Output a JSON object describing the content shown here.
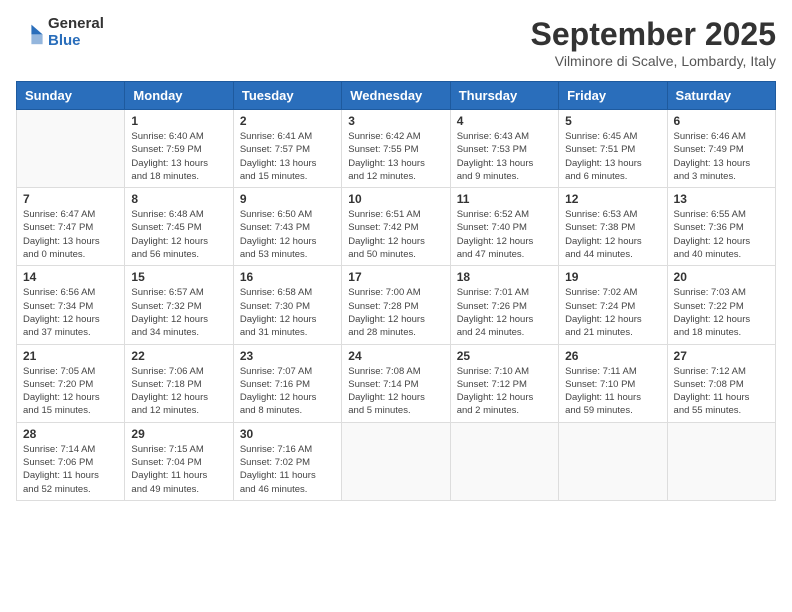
{
  "logo": {
    "general": "General",
    "blue": "Blue"
  },
  "title": "September 2025",
  "location": "Vilminore di Scalve, Lombardy, Italy",
  "headers": [
    "Sunday",
    "Monday",
    "Tuesday",
    "Wednesday",
    "Thursday",
    "Friday",
    "Saturday"
  ],
  "weeks": [
    [
      {
        "day": "",
        "info": ""
      },
      {
        "day": "1",
        "info": "Sunrise: 6:40 AM\nSunset: 7:59 PM\nDaylight: 13 hours\nand 18 minutes."
      },
      {
        "day": "2",
        "info": "Sunrise: 6:41 AM\nSunset: 7:57 PM\nDaylight: 13 hours\nand 15 minutes."
      },
      {
        "day": "3",
        "info": "Sunrise: 6:42 AM\nSunset: 7:55 PM\nDaylight: 13 hours\nand 12 minutes."
      },
      {
        "day": "4",
        "info": "Sunrise: 6:43 AM\nSunset: 7:53 PM\nDaylight: 13 hours\nand 9 minutes."
      },
      {
        "day": "5",
        "info": "Sunrise: 6:45 AM\nSunset: 7:51 PM\nDaylight: 13 hours\nand 6 minutes."
      },
      {
        "day": "6",
        "info": "Sunrise: 6:46 AM\nSunset: 7:49 PM\nDaylight: 13 hours\nand 3 minutes."
      }
    ],
    [
      {
        "day": "7",
        "info": "Sunrise: 6:47 AM\nSunset: 7:47 PM\nDaylight: 13 hours\nand 0 minutes."
      },
      {
        "day": "8",
        "info": "Sunrise: 6:48 AM\nSunset: 7:45 PM\nDaylight: 12 hours\nand 56 minutes."
      },
      {
        "day": "9",
        "info": "Sunrise: 6:50 AM\nSunset: 7:43 PM\nDaylight: 12 hours\nand 53 minutes."
      },
      {
        "day": "10",
        "info": "Sunrise: 6:51 AM\nSunset: 7:42 PM\nDaylight: 12 hours\nand 50 minutes."
      },
      {
        "day": "11",
        "info": "Sunrise: 6:52 AM\nSunset: 7:40 PM\nDaylight: 12 hours\nand 47 minutes."
      },
      {
        "day": "12",
        "info": "Sunrise: 6:53 AM\nSunset: 7:38 PM\nDaylight: 12 hours\nand 44 minutes."
      },
      {
        "day": "13",
        "info": "Sunrise: 6:55 AM\nSunset: 7:36 PM\nDaylight: 12 hours\nand 40 minutes."
      }
    ],
    [
      {
        "day": "14",
        "info": "Sunrise: 6:56 AM\nSunset: 7:34 PM\nDaylight: 12 hours\nand 37 minutes."
      },
      {
        "day": "15",
        "info": "Sunrise: 6:57 AM\nSunset: 7:32 PM\nDaylight: 12 hours\nand 34 minutes."
      },
      {
        "day": "16",
        "info": "Sunrise: 6:58 AM\nSunset: 7:30 PM\nDaylight: 12 hours\nand 31 minutes."
      },
      {
        "day": "17",
        "info": "Sunrise: 7:00 AM\nSunset: 7:28 PM\nDaylight: 12 hours\nand 28 minutes."
      },
      {
        "day": "18",
        "info": "Sunrise: 7:01 AM\nSunset: 7:26 PM\nDaylight: 12 hours\nand 24 minutes."
      },
      {
        "day": "19",
        "info": "Sunrise: 7:02 AM\nSunset: 7:24 PM\nDaylight: 12 hours\nand 21 minutes."
      },
      {
        "day": "20",
        "info": "Sunrise: 7:03 AM\nSunset: 7:22 PM\nDaylight: 12 hours\nand 18 minutes."
      }
    ],
    [
      {
        "day": "21",
        "info": "Sunrise: 7:05 AM\nSunset: 7:20 PM\nDaylight: 12 hours\nand 15 minutes."
      },
      {
        "day": "22",
        "info": "Sunrise: 7:06 AM\nSunset: 7:18 PM\nDaylight: 12 hours\nand 12 minutes."
      },
      {
        "day": "23",
        "info": "Sunrise: 7:07 AM\nSunset: 7:16 PM\nDaylight: 12 hours\nand 8 minutes."
      },
      {
        "day": "24",
        "info": "Sunrise: 7:08 AM\nSunset: 7:14 PM\nDaylight: 12 hours\nand 5 minutes."
      },
      {
        "day": "25",
        "info": "Sunrise: 7:10 AM\nSunset: 7:12 PM\nDaylight: 12 hours\nand 2 minutes."
      },
      {
        "day": "26",
        "info": "Sunrise: 7:11 AM\nSunset: 7:10 PM\nDaylight: 11 hours\nand 59 minutes."
      },
      {
        "day": "27",
        "info": "Sunrise: 7:12 AM\nSunset: 7:08 PM\nDaylight: 11 hours\nand 55 minutes."
      }
    ],
    [
      {
        "day": "28",
        "info": "Sunrise: 7:14 AM\nSunset: 7:06 PM\nDaylight: 11 hours\nand 52 minutes."
      },
      {
        "day": "29",
        "info": "Sunrise: 7:15 AM\nSunset: 7:04 PM\nDaylight: 11 hours\nand 49 minutes."
      },
      {
        "day": "30",
        "info": "Sunrise: 7:16 AM\nSunset: 7:02 PM\nDaylight: 11 hours\nand 46 minutes."
      },
      {
        "day": "",
        "info": ""
      },
      {
        "day": "",
        "info": ""
      },
      {
        "day": "",
        "info": ""
      },
      {
        "day": "",
        "info": ""
      }
    ]
  ]
}
